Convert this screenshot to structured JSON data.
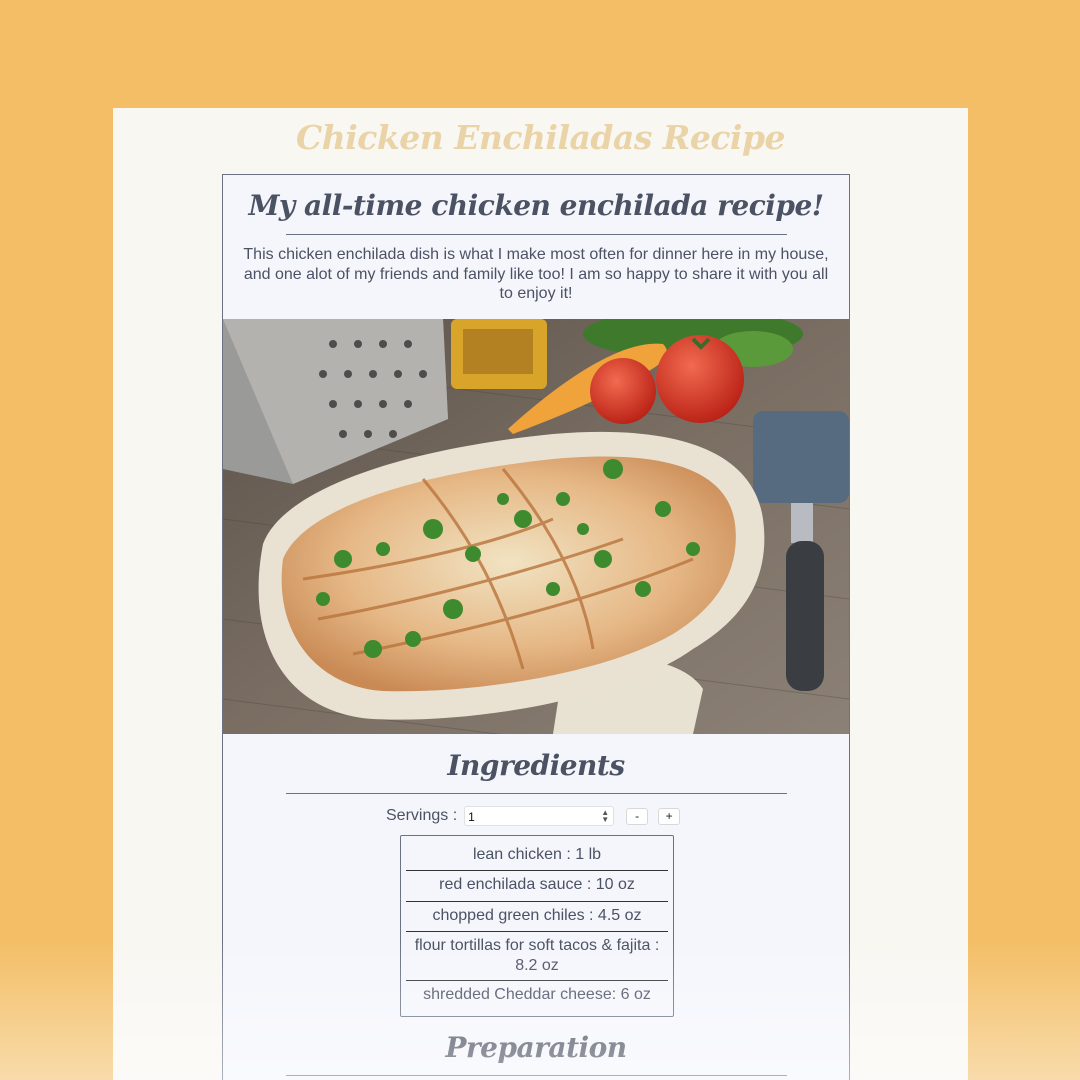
{
  "page": {
    "title": "Chicken Enchiladas Recipe"
  },
  "recipe": {
    "heading": "My all-time chicken enchilada recipe!",
    "intro": "This chicken enchilada dish is what I make most often for dinner here in my house, and one alot of my friends and family like too! I am so happy to share it with you all to enjoy it!",
    "photo_icon": "enchiladas-dish-photo"
  },
  "ingredients": {
    "heading": "Ingredients",
    "servings_label": "Servings :",
    "servings_value": "1",
    "decrement_label": "-",
    "increment_label": "+",
    "items": [
      "lean chicken : 1 lb",
      "red enchilada sauce : 10 oz",
      "chopped green chiles : 4.5 oz",
      "flour tortillas for soft tacos & fajita : 8.2 oz",
      "shredded Cheddar cheese: 6 oz"
    ]
  },
  "preparation": {
    "heading": "Preparation"
  },
  "colors": {
    "background": "#f3be66",
    "sheet": "#f9f7f2",
    "card": "#f5f6fc",
    "title": "#ead3a6",
    "text": "#4b5263"
  }
}
